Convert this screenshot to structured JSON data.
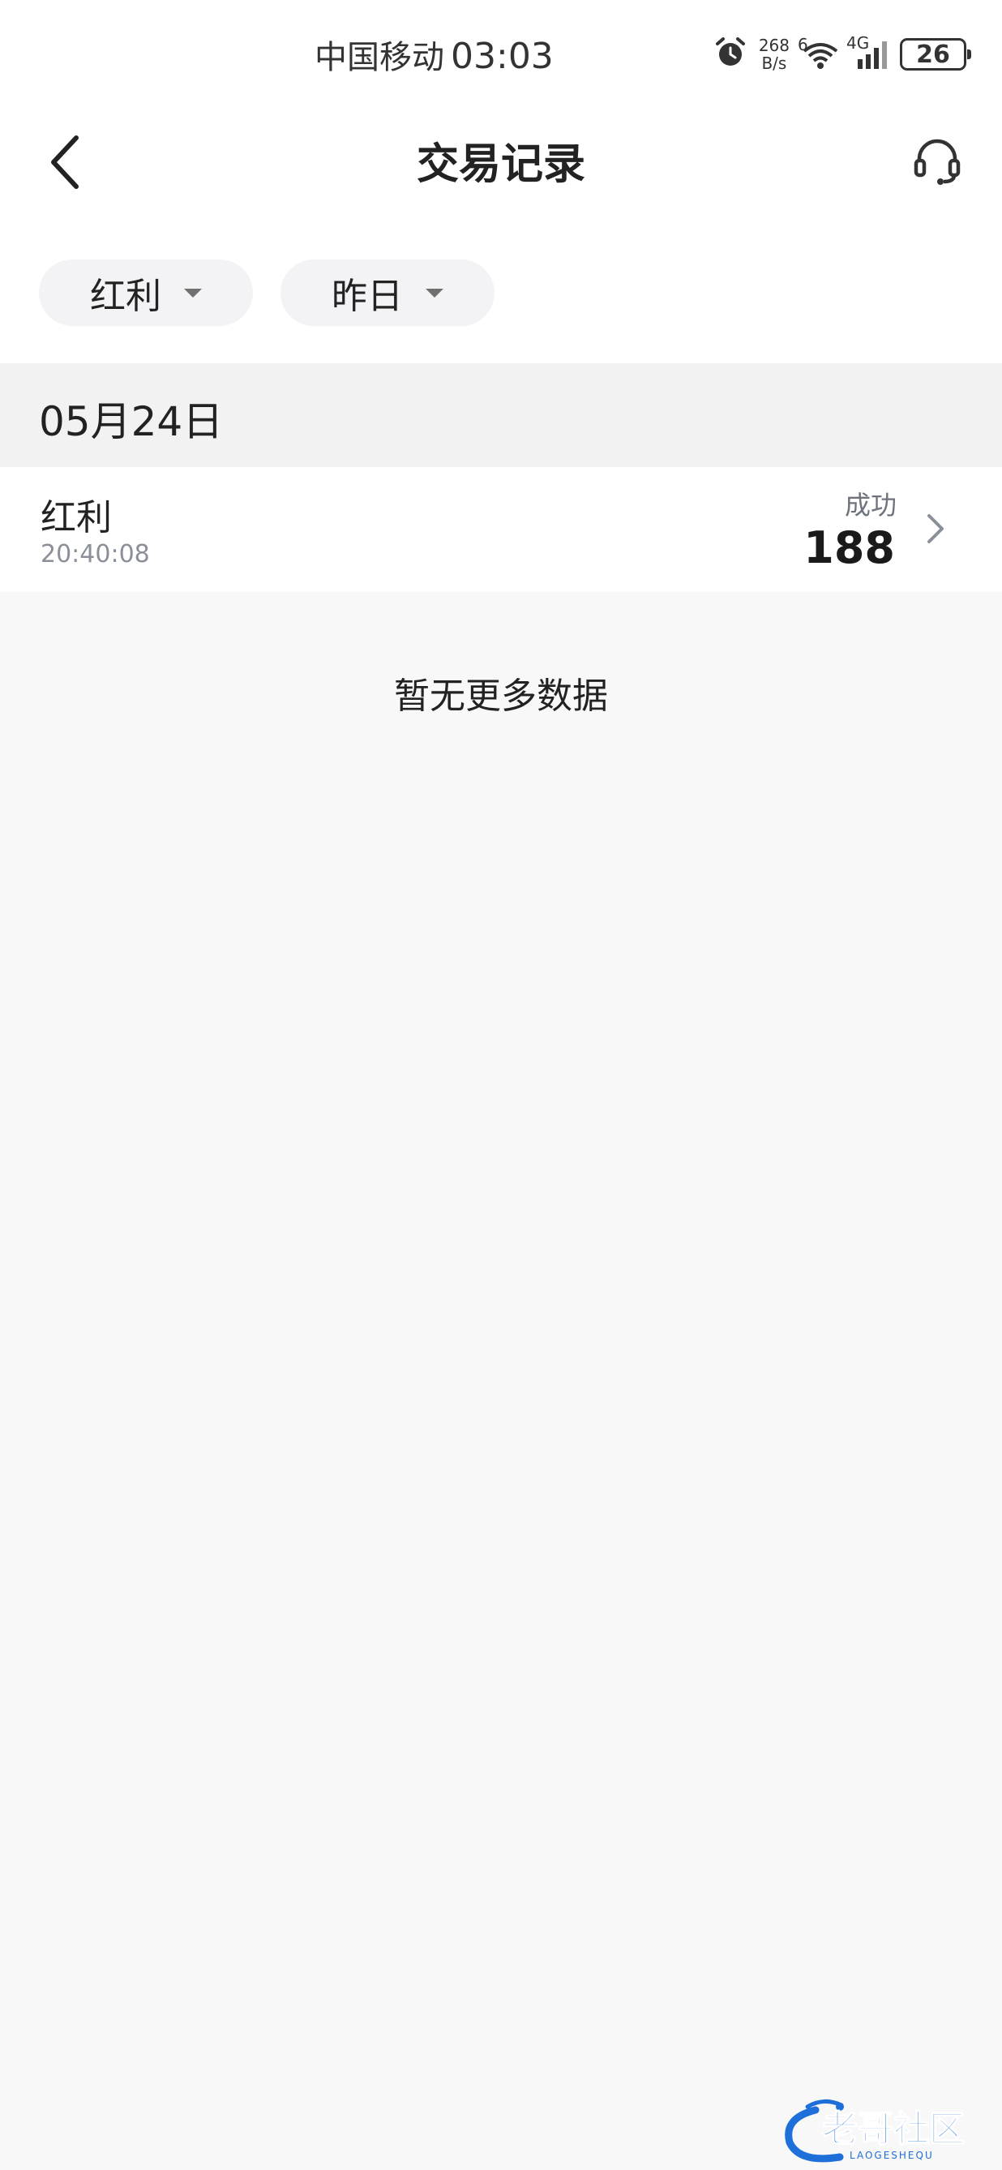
{
  "status_bar": {
    "carrier": "中国移动",
    "time": "03:03",
    "net_speed_value": "268",
    "net_speed_unit": "B/s",
    "wifi_label": "6",
    "cell_label": "4G",
    "battery": "26"
  },
  "nav": {
    "title": "交易记录",
    "back_icon": "chevron-left-icon",
    "support_icon": "headset-icon"
  },
  "filters": {
    "type_label": "红利",
    "date_label": "昨日"
  },
  "records": {
    "date_header": "05月24日",
    "items": [
      {
        "title": "红利",
        "time": "20:40:08",
        "status": "成功",
        "amount": "188"
      }
    ]
  },
  "empty_text": "暂无更多数据",
  "watermark": {
    "text": "老哥社区",
    "subtext": "LAOGESHEQU"
  },
  "colors": {
    "page_bg": "#f8f8f8",
    "section_bg": "#f2f2f2",
    "chip_bg": "#f3f3f5",
    "text_primary": "#222222",
    "text_secondary": "#8a8f99",
    "watermark_blue": "#1e6fd9"
  }
}
